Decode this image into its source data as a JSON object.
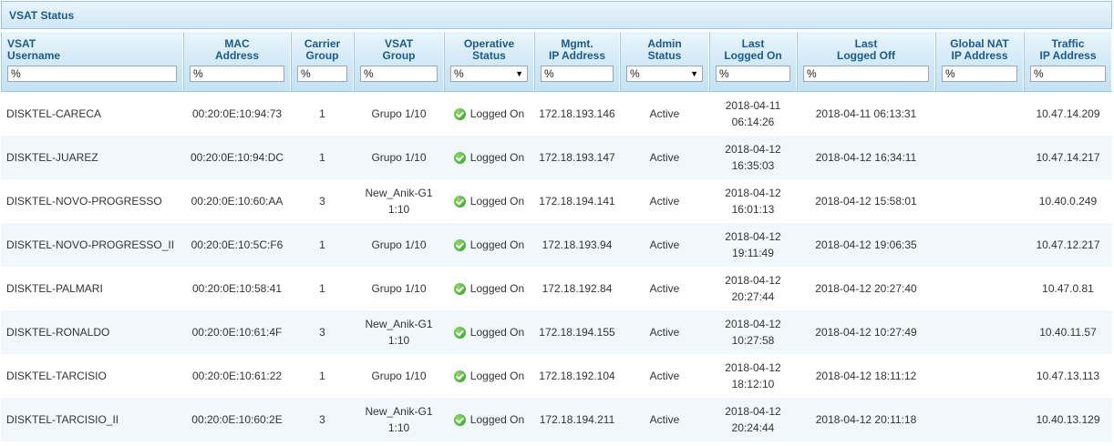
{
  "panel": {
    "title": "VSAT Status"
  },
  "columns": [
    {
      "key": "username",
      "label": "VSAT\nUsername",
      "filter": "%",
      "type": "text"
    },
    {
      "key": "mac",
      "label": "MAC\nAddress",
      "filter": "%",
      "type": "text"
    },
    {
      "key": "carrier",
      "label": "Carrier\nGroup",
      "filter": "%",
      "type": "text"
    },
    {
      "key": "vgroup",
      "label": "VSAT\nGroup",
      "filter": "%",
      "type": "text"
    },
    {
      "key": "opstatus",
      "label": "Operative\nStatus",
      "filter": "%",
      "type": "select"
    },
    {
      "key": "mgmt",
      "label": "Mgmt.\nIP Address",
      "filter": "%",
      "type": "text"
    },
    {
      "key": "admin",
      "label": "Admin\nStatus",
      "filter": "%",
      "type": "select"
    },
    {
      "key": "laston",
      "label": "Last\nLogged On",
      "filter": "%",
      "type": "text"
    },
    {
      "key": "lastoff",
      "label": "Last\nLogged Off",
      "filter": "%",
      "type": "text"
    },
    {
      "key": "nat",
      "label": "Global NAT\nIP Address",
      "filter": "%",
      "type": "text"
    },
    {
      "key": "traffic",
      "label": "Traffic\nIP Address",
      "filter": "%",
      "type": "text"
    }
  ],
  "rows": [
    {
      "username": "DISKTEL-CARECA",
      "mac": "00:20:0E:10:94:73",
      "carrier": "1",
      "vgroup": "Grupo 1/10",
      "opstatus": "Logged On",
      "mgmt": "172.18.193.146",
      "admin": "Active",
      "laston": "2018-04-11\n06:14:26",
      "lastoff": "2018-04-11 06:13:31",
      "nat": "",
      "traffic": "10.47.14.209"
    },
    {
      "username": "DISKTEL-JUAREZ",
      "mac": "00:20:0E:10:94:DC",
      "carrier": "1",
      "vgroup": "Grupo 1/10",
      "opstatus": "Logged On",
      "mgmt": "172.18.193.147",
      "admin": "Active",
      "laston": "2018-04-12\n16:35:03",
      "lastoff": "2018-04-12 16:34:11",
      "nat": "",
      "traffic": "10.47.14.217"
    },
    {
      "username": "DISKTEL-NOVO-PROGRESSO",
      "mac": "00:20:0E:10:60:AA",
      "carrier": "3",
      "vgroup": "New_Anik-G1\n1:10",
      "opstatus": "Logged On",
      "mgmt": "172.18.194.141",
      "admin": "Active",
      "laston": "2018-04-12\n16:01:13",
      "lastoff": "2018-04-12 15:58:01",
      "nat": "",
      "traffic": "10.40.0.249"
    },
    {
      "username": "DISKTEL-NOVO-PROGRESSO_II",
      "mac": "00:20:0E:10:5C:F6",
      "carrier": "1",
      "vgroup": "Grupo 1/10",
      "opstatus": "Logged On",
      "mgmt": "172.18.193.94",
      "admin": "Active",
      "laston": "2018-04-12\n19:11:49",
      "lastoff": "2018-04-12 19:06:35",
      "nat": "",
      "traffic": "10.47.12.217"
    },
    {
      "username": "DISKTEL-PALMARI",
      "mac": "00:20:0E:10:58:41",
      "carrier": "1",
      "vgroup": "Grupo 1/10",
      "opstatus": "Logged On",
      "mgmt": "172.18.192.84",
      "admin": "Active",
      "laston": "2018-04-12\n20:27:44",
      "lastoff": "2018-04-12 20:27:40",
      "nat": "",
      "traffic": "10.47.0.81"
    },
    {
      "username": "DISKTEL-RONALDO",
      "mac": "00:20:0E:10:61:4F",
      "carrier": "3",
      "vgroup": "New_Anik-G1\n1:10",
      "opstatus": "Logged On",
      "mgmt": "172.18.194.155",
      "admin": "Active",
      "laston": "2018-04-12\n10:27:58",
      "lastoff": "2018-04-12 10:27:49",
      "nat": "",
      "traffic": "10.40.11.57"
    },
    {
      "username": "DISKTEL-TARCISIO",
      "mac": "00:20:0E:10:61:22",
      "carrier": "1",
      "vgroup": "Grupo 1/10",
      "opstatus": "Logged On",
      "mgmt": "172.18.192.104",
      "admin": "Active",
      "laston": "2018-04-12\n18:12:10",
      "lastoff": "2018-04-12 18:11:12",
      "nat": "",
      "traffic": "10.47.13.113"
    },
    {
      "username": "DISKTEL-TARCISIO_II",
      "mac": "00:20:0E:10:60:2E",
      "carrier": "3",
      "vgroup": "New_Anik-G1\n1:10",
      "opstatus": "Logged On",
      "mgmt": "172.18.194.211",
      "admin": "Active",
      "laston": "2018-04-12\n20:24:44",
      "lastoff": "2018-04-12 20:11:18",
      "nat": "",
      "traffic": "10.40.13.129"
    }
  ],
  "colors": {
    "header_text": "#1a5a8c",
    "alt_row": "#f1f8fc",
    "status_ok": "#2f9a1d"
  },
  "icons": {
    "status_ok": "check-circle-icon"
  }
}
